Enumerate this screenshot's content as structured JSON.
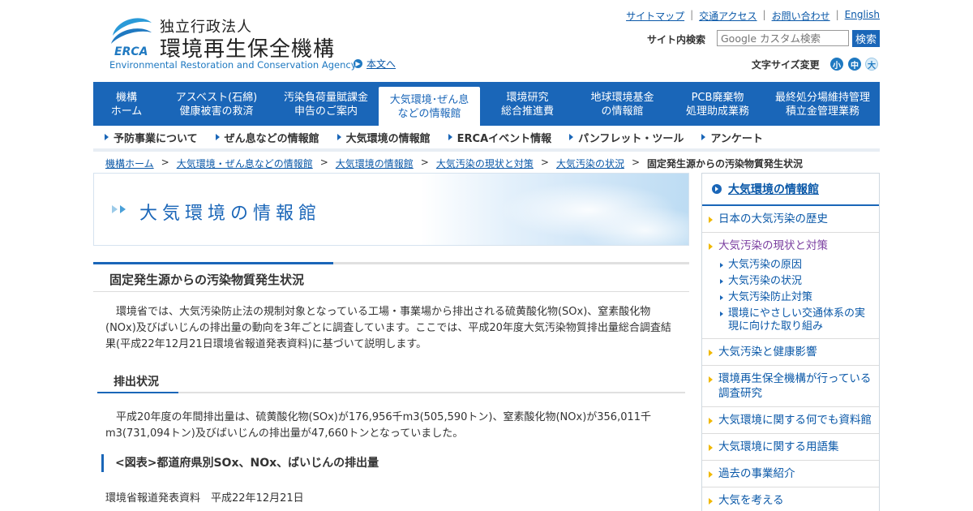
{
  "header": {
    "org_sub": "独立行政法人",
    "org_main": "環境再生保全機構",
    "logo_text": "ERCA",
    "org_en": "Environmental Restoration and Conservation Agency",
    "skip_link": "本文へ",
    "util_links": [
      "サイトマップ",
      "交通アクセス",
      "お問い合わせ",
      "English"
    ],
    "search_label": "サイト内検索",
    "search_placeholder": "Google カスタム検索",
    "search_button": "検索",
    "font_size_label": "文字サイズ変更",
    "font_sizes": [
      "小",
      "中",
      "大"
    ]
  },
  "main_nav": [
    {
      "line1": "機構",
      "line2": "ホーム"
    },
    {
      "line1": "アスベスト(石綿)",
      "line2": "健康被害の救済"
    },
    {
      "line1": "汚染負荷量賦課金",
      "line2": "申告のご案内"
    },
    {
      "line1": "大気環境･ぜん息",
      "line2": "などの情報館"
    },
    {
      "line1": "環境研究",
      "line2": "総合推進費"
    },
    {
      "line1": "地球環境基金",
      "line2": "の情報館"
    },
    {
      "line1": "PCB廃棄物",
      "line2": "処理助成業務"
    },
    {
      "line1": "最終処分場維持管理",
      "line2": "積立金管理業務"
    }
  ],
  "sub_nav": [
    "予防事業について",
    "ぜん息などの情報館",
    "大気環境の情報館",
    "ERCAイベント情報",
    "パンフレット・ツール",
    "アンケート"
  ],
  "breadcrumb": [
    "機構ホーム",
    "大気環境・ぜん息などの情報館",
    "大気環境の情報館",
    "大気汚染の現状と対策",
    "大気汚染の状況",
    "固定発生源からの汚染物質発生状況"
  ],
  "banner_title": "大気環境の情報館",
  "page_title": "固定発生源からの汚染物質発生状況",
  "intro_paragraph": "環境省では、大気汚染防止法の規制対象となっている工場・事業場から排出される硫黄酸化物(SOx)、窒素酸化物(NOx)及びばいじんの排出量の動向を3年ごとに調査しています。ここでは、平成20年度大気汚染物質排出量総合調査結果(平成22年12月21日環境省報道発表資料)に基づいて説明します。",
  "section_title": "排出状況",
  "section_paragraph": "平成20年度の年間排出量は、硫黄酸化物(SOx)が176,956千m3(505,590トン)、窒素酸化物(NOx)が356,011千m3(731,094トン)及びばいじんの排出量が47,660トンとなっていました。",
  "figure_title": "<図表>都道府県別SOx、NOx、ばいじんの排出量",
  "source_line": "環境省報道発表資料　平成22年12月21日",
  "side_menu": {
    "title": "大気環境の情報館",
    "items": [
      "日本の大気汚染の歴史",
      "大気汚染の現状と対策",
      "大気汚染と健康影響",
      "環境再生保全機構が行っている調査研究",
      "大気環境に関する何でも資料館",
      "大気環境に関する用語集",
      "過去の事業紹介",
      "大気を考える"
    ],
    "sub_items": [
      "大気汚染の原因",
      "大気汚染の状況",
      "大気汚染防止対策",
      "環境にやさしい交通体系の実現に向けた取り組み"
    ]
  },
  "colors": {
    "brand_blue": "#1a66b8",
    "link_blue": "#0a58a8",
    "bullet_yellow": "#f0b800",
    "visited_purple": "#7b3fa0"
  }
}
